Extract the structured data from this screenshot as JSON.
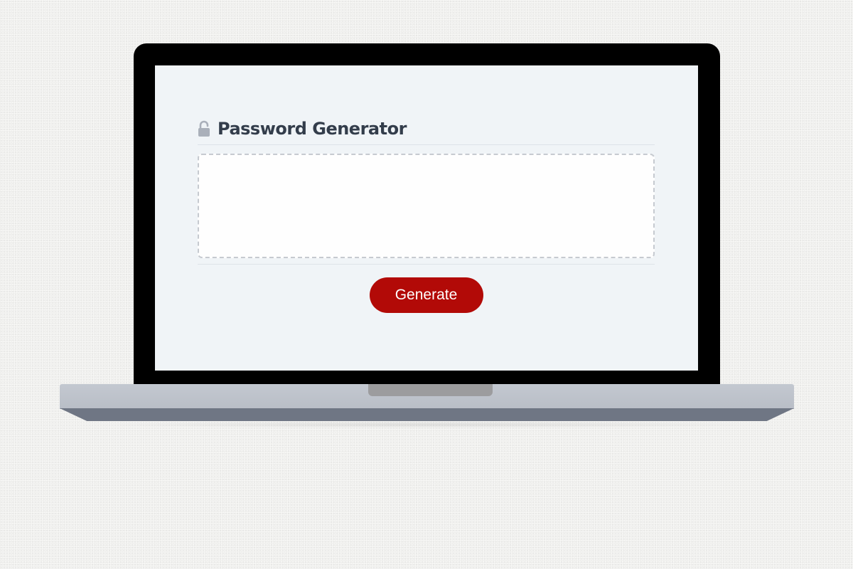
{
  "app": {
    "title": "Password Generator",
    "lock_icon": "unlocked-padlock-icon"
  },
  "password": {
    "value": "",
    "placeholder": ""
  },
  "actions": {
    "generate_label": "Generate"
  },
  "colors": {
    "accent": "#b20a07",
    "title_text": "#333d4b",
    "screen_background": "#f0f4f7",
    "bezel": "#000000",
    "laptop_base": "#c3c8d0"
  }
}
